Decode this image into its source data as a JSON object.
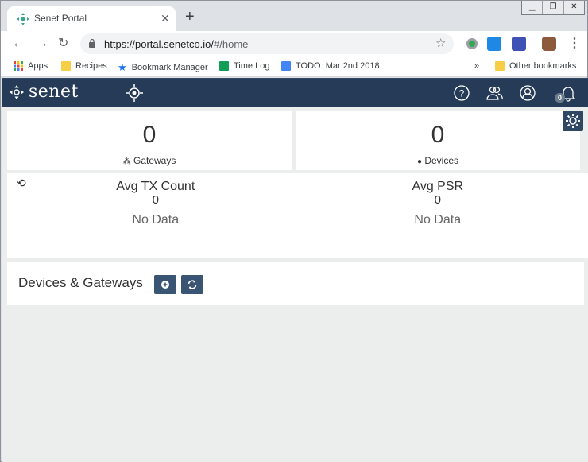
{
  "browser": {
    "tab_title": "Senet Portal",
    "tab_close": "✕",
    "new_tab": "+",
    "url_host": "https://portal.senetco.io/",
    "url_path": "#/home",
    "window_controls": [
      "▭",
      "❐",
      "✕"
    ],
    "bookmarks": [
      {
        "label": "Apps",
        "icon": "apps-grid-icon"
      },
      {
        "label": "Recipes",
        "icon": "folder-icon"
      },
      {
        "label": "Bookmark Manager",
        "icon": "star-icon"
      },
      {
        "label": "Time Log",
        "icon": "sheets-icon"
      },
      {
        "label": "TODO: Mar 2nd 2018",
        "icon": "docs-icon"
      }
    ],
    "more_bookmarks": "»",
    "other_bookmarks": "Other bookmarks"
  },
  "app": {
    "brand": "senet",
    "notification_count": "0",
    "gateways": {
      "value": "0",
      "label": "Gateways"
    },
    "devices": {
      "value": "0",
      "label": "Devices"
    },
    "avg_tx": {
      "title": "Avg TX Count",
      "value": "0",
      "status": "No Data"
    },
    "avg_psr": {
      "title": "Avg PSR",
      "value": "0",
      "status": "No Data"
    },
    "section_title": "Devices & Gateways"
  },
  "colors": {
    "navbar": "#253b57",
    "button": "#3a5573",
    "page_bg": "#eceeee"
  }
}
